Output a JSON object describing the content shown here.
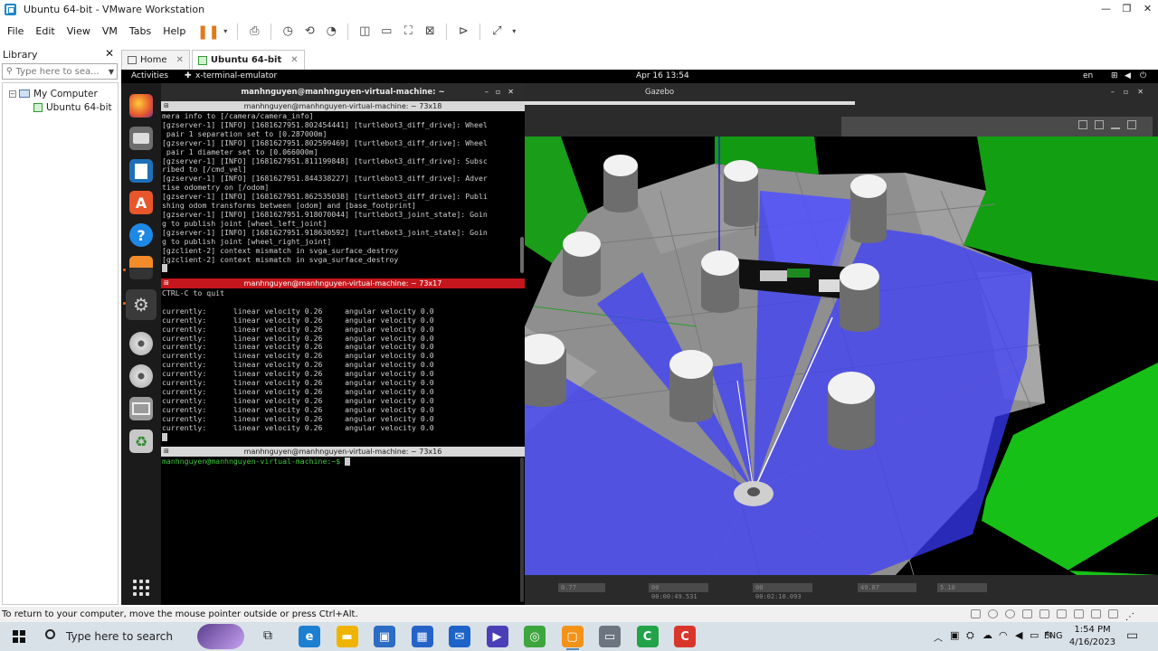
{
  "window": {
    "title": "Ubuntu 64-bit - VMware Workstation",
    "controls": [
      "—",
      "❐",
      "✕"
    ]
  },
  "menu": [
    "File",
    "Edit",
    "View",
    "VM",
    "Tabs",
    "Help"
  ],
  "library": {
    "title": "Library",
    "close": "✕",
    "search_placeholder": "Type here to sea...",
    "tree": {
      "root": "My Computer",
      "child": "Ubuntu 64-bit",
      "toggle": "−"
    }
  },
  "tabs": [
    {
      "label": "Home",
      "close": "✕"
    },
    {
      "label": "Ubuntu 64-bit",
      "close": "✕"
    }
  ],
  "guest_topbar": {
    "activities": "Activities",
    "app": "x-terminal-emulator",
    "clock": "Apr 16  13:54",
    "lang": "en"
  },
  "terminal_header": {
    "title": "manhnguyen@manhnguyen-virtual-machine: ~",
    "buttons": "–▫✕"
  },
  "terminal1": {
    "title": "manhnguyen@manhnguyen-virtual-machine: ~ 73x18",
    "lines": [
      "mera info to [/camera/camera_info]",
      "[gzserver-1] [INFO] [1681627951.802454441] [turtlebot3_diff_drive]: Wheel",
      " pair 1 separation set to [0.287000m]",
      "[gzserver-1] [INFO] [1681627951.802599469] [turtlebot3_diff_drive]: Wheel",
      " pair 1 diameter set to [0.066000m]",
      "[gzserver-1] [INFO] [1681627951.811199848] [turtlebot3_diff_drive]: Subsc",
      "ribed to [/cmd_vel]",
      "[gzserver-1] [INFO] [1681627951.844338227] [turtlebot3_diff_drive]: Adver",
      "tise odometry on [/odom]",
      "[gzserver-1] [INFO] [1681627951.862535038] [turtlebot3_diff_drive]: Publi",
      "shing odom transforms between [odom] and [base_footprint]",
      "[gzserver-1] [INFO] [1681627951.918070044] [turtlebot3_joint_state]: Goin",
      "g to publish joint [wheel_left_joint]",
      "[gzserver-1] [INFO] [1681627951.918630592] [turtlebot3_joint_state]: Goin",
      "g to publish joint [wheel_right_joint]",
      "[gzclient-2] context mismatch in svga_surface_destroy",
      "[gzclient-2] context mismatch in svga_surface_destroy"
    ]
  },
  "terminal2": {
    "title": "manhnguyen@manhnguyen-virtual-machine: ~ 73x17",
    "quit_line": "CTRL-C to quit",
    "row_label": "currently:",
    "linear": "linear velocity 0.26",
    "angular": "angular velocity 0.0",
    "row_count": 14
  },
  "terminal3": {
    "title": "manhnguyen@manhnguyen-virtual-machine: ~ 73x16",
    "prompt": "manhnguyen@manhnguyen-virtual-machine:~$"
  },
  "gazebo": {
    "title": "Gazebo",
    "buttons": "–▫✕",
    "status_fields": [
      "0.77",
      "00 00:00:49.531",
      "00 00:02:10.093",
      "49.87",
      "5.10"
    ]
  },
  "vm_status": {
    "text": "To return to your computer, move the mouse pointer outside or press Ctrl+Alt."
  },
  "taskbar": {
    "search": "Type here to search",
    "apps": [
      {
        "name": "edge",
        "color": "#1d7fd2",
        "glyph": "e"
      },
      {
        "name": "explorer",
        "color": "#f0b400",
        "glyph": "▬"
      },
      {
        "name": "store",
        "color": "#2b6cc4",
        "glyph": "▣"
      },
      {
        "name": "photos",
        "color": "#2563c9",
        "glyph": "▦"
      },
      {
        "name": "mail",
        "color": "#1e64c8",
        "glyph": "✉"
      },
      {
        "name": "media",
        "color": "#4b3fb8",
        "glyph": "▶"
      },
      {
        "name": "app-green",
        "color": "#3da63d",
        "glyph": "◎"
      },
      {
        "name": "vmware",
        "color": "#f29318",
        "glyph": "▢"
      },
      {
        "name": "app-gray",
        "color": "#6d7680",
        "glyph": "▭"
      },
      {
        "name": "app-green-2",
        "color": "#22a34a",
        "glyph": "C"
      },
      {
        "name": "app-red",
        "color": "#d9362b",
        "glyph": "C"
      }
    ],
    "lang": "ENG",
    "time": "1:54 PM",
    "date": "4/16/2023"
  }
}
